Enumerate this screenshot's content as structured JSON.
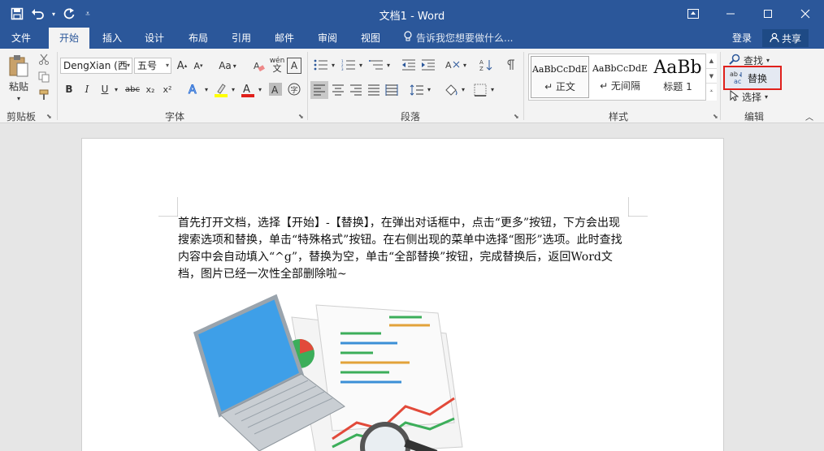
{
  "window": {
    "title": "文档1 - Word"
  },
  "qat": {
    "save_icon": "save-icon",
    "undo_icon": "undo-icon",
    "redo_icon": "redo-icon"
  },
  "tabs": [
    {
      "label": "文件"
    },
    {
      "label": "开始"
    },
    {
      "label": "插入"
    },
    {
      "label": "设计"
    },
    {
      "label": "布局"
    },
    {
      "label": "引用"
    },
    {
      "label": "邮件"
    },
    {
      "label": "审阅"
    },
    {
      "label": "视图"
    }
  ],
  "tellme": "告诉我您想要做什么...",
  "account": {
    "login": "登录",
    "share": "共享"
  },
  "clipboard": {
    "paste": "粘贴",
    "group": "剪贴板"
  },
  "font": {
    "name": "DengXian (西",
    "size": "五号",
    "group": "字体",
    "change_case": "Aa",
    "wen": "wén",
    "bold": "B",
    "italic": "I",
    "underline": "U",
    "strike": "abc",
    "sub": "x₂",
    "sup": "x²",
    "clear": "A",
    "grow": "A",
    "shrink": "A",
    "phonetic_box": "A"
  },
  "paragraph": {
    "group": "段落"
  },
  "styles": {
    "group": "样式",
    "items": [
      {
        "sample": "AaBbCcDdE",
        "name": "↵ 正文"
      },
      {
        "sample": "AaBbCcDdE",
        "name": "↵ 无间隔"
      },
      {
        "sample": "AaBb",
        "name": "标题 1"
      }
    ]
  },
  "editing": {
    "find": "查找",
    "replace": "替换",
    "select": "选择",
    "group": "编辑"
  },
  "colors": {
    "accent": "#2b579a",
    "highlight": "#e0201b"
  },
  "document": {
    "paragraph": "首先打开文档，选择【开始】-【替换】，在弹出对话框中，点击“更多”按钮，下方会出现搜索选项和替换，单击“特殊格式”按钮。在右侧出现的菜单中选择“图形”选项。此时查找内容中会自动填入“^g”，替换为空，单击“全部替换”按钮，完成替换后，返回Word文档，图片已经一次性全部删除啦~"
  }
}
